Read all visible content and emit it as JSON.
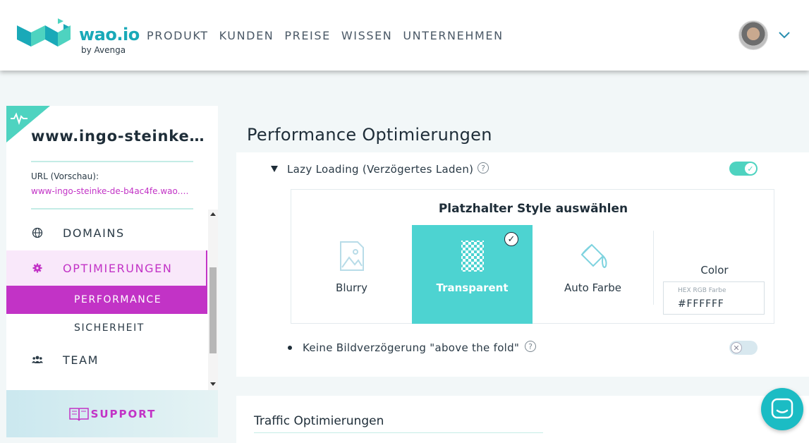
{
  "brand": {
    "name": "wao.io",
    "sub": "by Avenga",
    "color": "#1aa9b8"
  },
  "nav": {
    "items": [
      "PRODUKT",
      "KUNDEN",
      "PREISE",
      "WISSEN",
      "UNTERNEHMEN"
    ]
  },
  "header": {
    "avatar_icon": "user-avatar",
    "menu_icon": "chevron-down-icon"
  },
  "sidebar": {
    "site_title": "www.ingo-steinke…",
    "url_label": "URL (Vorschau):",
    "url_value": "www-ingo-steinke-de-b4ac4fe.wao.…",
    "items": [
      {
        "label": "DOMAINS",
        "icon": "globe-icon"
      },
      {
        "label": "OPTIMIERUNGEN",
        "icon": "gear-icon",
        "active": true
      },
      {
        "label": "PERFORMANCE",
        "sub": true,
        "active": true
      },
      {
        "label": "SICHERHEIT",
        "sub": true
      },
      {
        "label": "TEAM",
        "icon": "team-icon"
      }
    ],
    "support_label": "SUPPORT",
    "accent_color": "#c233c6"
  },
  "main": {
    "page_title": "Performance Optimierungen",
    "lazy": {
      "label": "Lazy Loading (Verzögertes Laden)",
      "help": "?",
      "enabled": true
    },
    "placeholder": {
      "title": "Platzhalter Style auswählen",
      "options": [
        {
          "label": "Blurry",
          "icon": "image-icon"
        },
        {
          "label": "Transparent",
          "icon": "checkerboard-icon",
          "selected": true
        },
        {
          "label": "Auto Farbe",
          "icon": "paint-bucket-icon"
        }
      ],
      "color_label": "Color",
      "hex_caption": "HEX RGB Farbe",
      "hex_value": "#FFFFFF",
      "selected_color": "#4dd3d1"
    },
    "fold": {
      "label": "Keine Bildverzögerung \"above the fold\"",
      "help": "?",
      "enabled": false
    },
    "traffic_title": "Traffic Optimierungen"
  },
  "chat": {
    "icon": "chat-icon"
  }
}
